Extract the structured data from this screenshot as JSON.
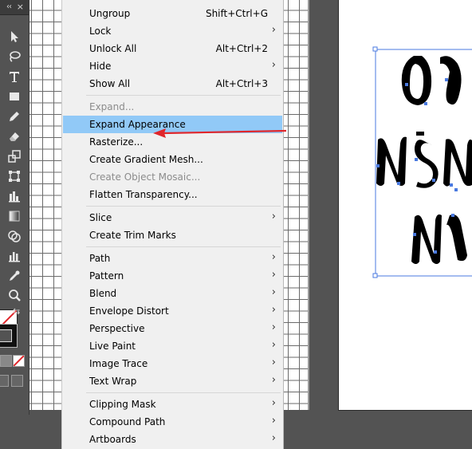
{
  "colors": {
    "menu_bg": "#f0f0f0",
    "highlight": "#91c9f7",
    "annotation_arrow": "#e0262b",
    "selection": "#4a7ae0"
  },
  "toolbar": {
    "tools": [
      "selection-tool-icon",
      "lasso-tool-icon",
      "type-tool-icon",
      "rectangle-tool-icon",
      "pencil-tool-icon",
      "eraser-tool-icon",
      "scale-tool-icon",
      "free-transform-tool-icon",
      "graph-tool-icon",
      "gradient-tool-icon",
      "shape-builder-tool-icon",
      "column-graph-tool-icon",
      "eyedropper-tool-icon",
      "zoom-tool-icon"
    ]
  },
  "menu": {
    "items": [
      {
        "label": "Ungroup",
        "shortcut": "Shift+Ctrl+G",
        "submenu": false,
        "disabled": false
      },
      {
        "label": "Lock",
        "shortcut": "",
        "submenu": true,
        "disabled": false
      },
      {
        "label": "Unlock All",
        "shortcut": "Alt+Ctrl+2",
        "submenu": false,
        "disabled": false
      },
      {
        "label": "Hide",
        "shortcut": "",
        "submenu": true,
        "disabled": false
      },
      {
        "label": "Show All",
        "shortcut": "Alt+Ctrl+3",
        "submenu": false,
        "disabled": false
      },
      {
        "label": "Expand...",
        "shortcut": "",
        "submenu": false,
        "disabled": true
      },
      {
        "label": "Expand Appearance",
        "shortcut": "",
        "submenu": false,
        "disabled": false,
        "highlighted": true
      },
      {
        "label": "Rasterize...",
        "shortcut": "",
        "submenu": false,
        "disabled": false
      },
      {
        "label": "Create Gradient Mesh...",
        "shortcut": "",
        "submenu": false,
        "disabled": false
      },
      {
        "label": "Create Object Mosaic...",
        "shortcut": "",
        "submenu": false,
        "disabled": true
      },
      {
        "label": "Flatten Transparency...",
        "shortcut": "",
        "submenu": false,
        "disabled": false
      },
      {
        "label": "Slice",
        "shortcut": "",
        "submenu": true,
        "disabled": false
      },
      {
        "label": "Create Trim Marks",
        "shortcut": "",
        "submenu": false,
        "disabled": false
      },
      {
        "label": "Path",
        "shortcut": "",
        "submenu": true,
        "disabled": false
      },
      {
        "label": "Pattern",
        "shortcut": "",
        "submenu": true,
        "disabled": false
      },
      {
        "label": "Blend",
        "shortcut": "",
        "submenu": true,
        "disabled": false
      },
      {
        "label": "Envelope Distort",
        "shortcut": "",
        "submenu": true,
        "disabled": false
      },
      {
        "label": "Perspective",
        "shortcut": "",
        "submenu": true,
        "disabled": false
      },
      {
        "label": "Live Paint",
        "shortcut": "",
        "submenu": true,
        "disabled": false
      },
      {
        "label": "Image Trace",
        "shortcut": "",
        "submenu": true,
        "disabled": false
      },
      {
        "label": "Text Wrap",
        "shortcut": "",
        "submenu": true,
        "disabled": false
      },
      {
        "label": "Clipping Mask",
        "shortcut": "",
        "submenu": true,
        "disabled": false
      },
      {
        "label": "Compound Path",
        "shortcut": "",
        "submenu": true,
        "disabled": false
      },
      {
        "label": "Artboards",
        "shortcut": "",
        "submenu": true,
        "disabled": false
      }
    ]
  }
}
